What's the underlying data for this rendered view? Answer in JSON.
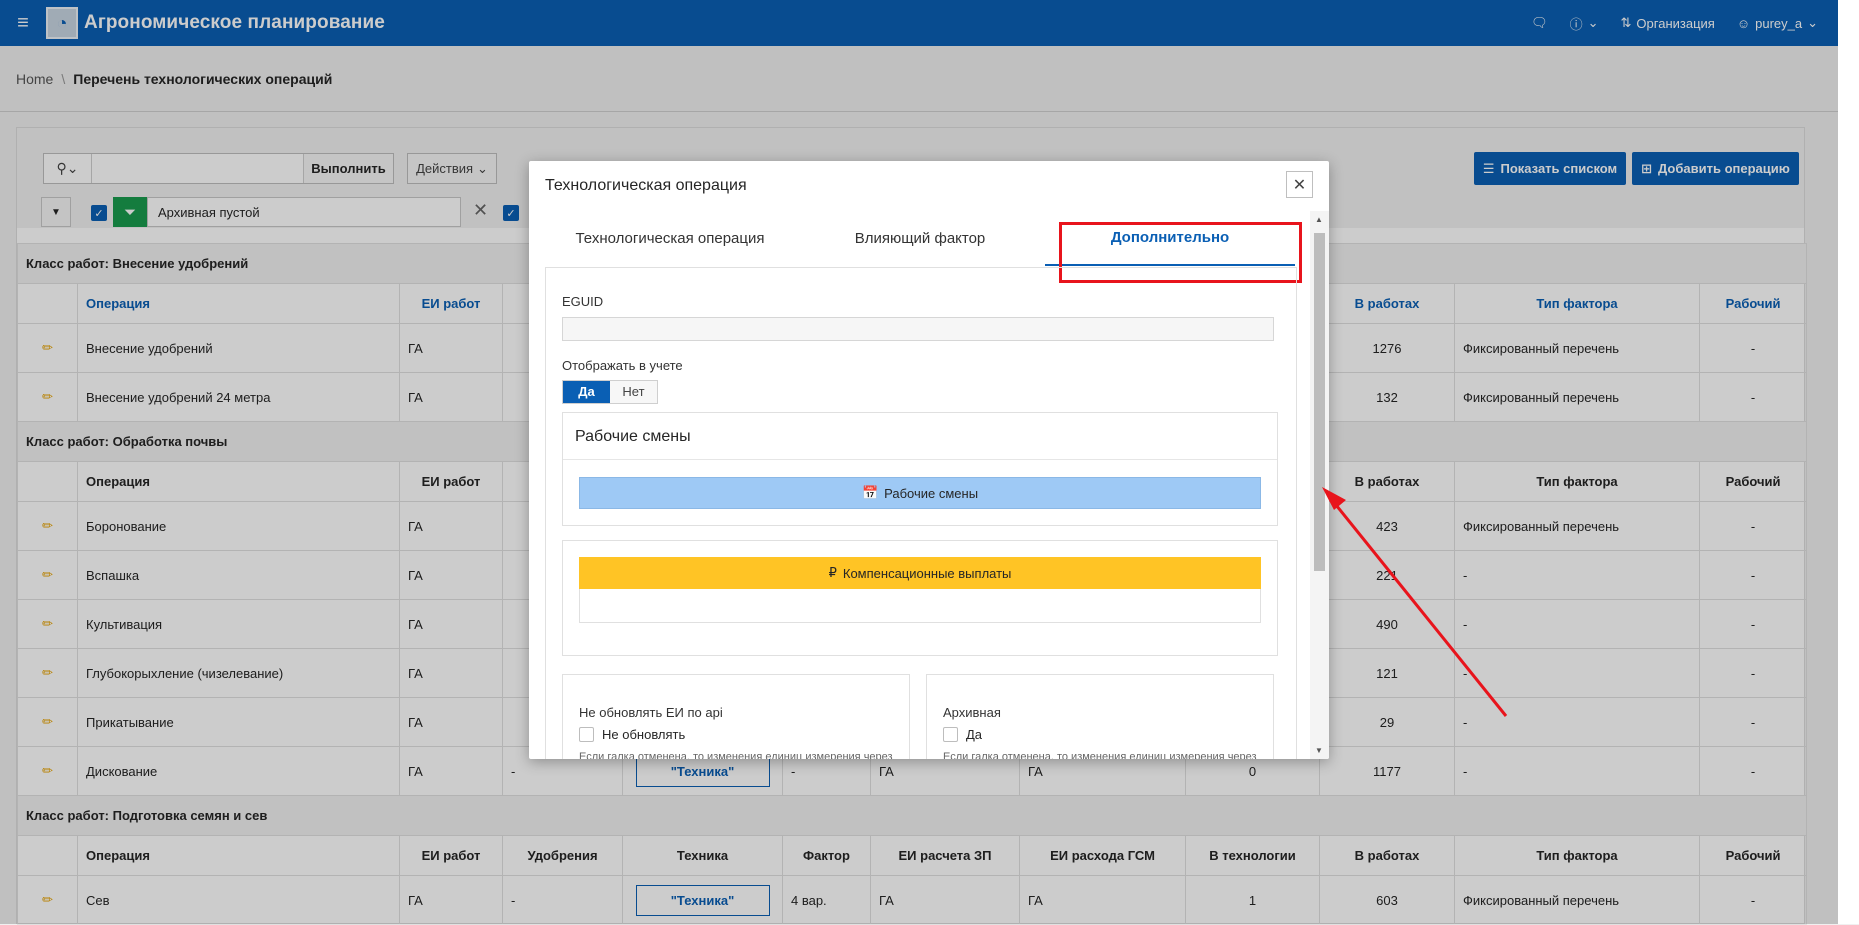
{
  "app": {
    "title": "Агрономическое планирование"
  },
  "header": {
    "organization": "Организация",
    "user": "purey_a"
  },
  "breadcrumb": {
    "home": "Home",
    "current": "Перечень технологических операций"
  },
  "toolbar": {
    "go_label": "Выполнить",
    "actions_label": "Действия",
    "show_list_label": "Показать списком",
    "add_operation_label": "Добавить операцию",
    "filter_text": "Архивная пустой"
  },
  "table": {
    "groups": [
      {
        "title": "Класс работ: Внесение удобрений"
      },
      {
        "title": "Класс работ: Обработка почвы"
      },
      {
        "title": "Класс работ: Подготовка семян и сев"
      }
    ],
    "headers": {
      "operation": "Операция",
      "unit": "ЕИ работ",
      "fertilizer": "Удобрения",
      "tech": "Техника",
      "factor": "Фактор",
      "wage_unit": "ЕИ расчета ЗП",
      "fuel_unit": "ЕИ расхода ГСМ",
      "in_tech": "В технологии",
      "in_works": "В работах",
      "factor_type": "Тип фактора",
      "worker": "Рабочий"
    },
    "rows": [
      {
        "op": "Внесение удобрений",
        "unit": "ГА",
        "works": "1276",
        "type": "Фиксированный перечень",
        "worker": "-"
      },
      {
        "op": "Внесение удобрений 24 метра",
        "unit": "ГА",
        "works": "132",
        "type": "Фиксированный перечень",
        "worker": "-"
      },
      {
        "op": "Боронование",
        "unit": "ГА",
        "works": "423",
        "type": "Фиксированный перечень",
        "worker": "-"
      },
      {
        "op": "Вспашка",
        "unit": "ГА",
        "works": "221",
        "type": "-",
        "worker": "-"
      },
      {
        "op": "Культивация",
        "unit": "ГА",
        "works": "490",
        "type": "-",
        "worker": "-"
      },
      {
        "op": "Глубокорыхление (чизелевание)",
        "unit": "ГА",
        "works": "121",
        "type": "-",
        "worker": "-"
      },
      {
        "op": "Прикатывание",
        "unit": "ГА",
        "works": "29",
        "type": "-",
        "worker": "-"
      },
      {
        "op": "Дискование",
        "unit": "ГА",
        "fert": "-",
        "tech": "\"Техника\"",
        "factor": "-",
        "wage": "ГА",
        "fuel": "ГА",
        "intech": "0",
        "works": "1177",
        "type": "-",
        "worker": "-"
      },
      {
        "op": "Сев",
        "unit": "ГА",
        "fert": "-",
        "tech": "\"Техника\"",
        "factor": "4 вар.",
        "wage": "ГА",
        "fuel": "ГА",
        "intech": "1",
        "works": "603",
        "type": "Фиксированный перечень",
        "worker": "-"
      }
    ]
  },
  "dialog": {
    "title": "Технологическая операция",
    "tabs": [
      "Технологическая операция",
      "Влияющий фактор",
      "Дополнительно"
    ],
    "eguid_label": "EGUID",
    "show_in_accounting_label": "Отображать в учете",
    "yes": "Да",
    "no": "Нет",
    "shifts_panel_title": "Рабочие смены",
    "shifts_button": "Рабочие смены",
    "compensation_button": "Компенсационные выплаты",
    "no_update_label": "Не обновлять ЕИ по api",
    "no_update_checkbox": "Не обновлять",
    "archive_label": "Архивная",
    "archive_checkbox": "Да",
    "hint_text": "Если галка отменена, то изменения единиц измерения через"
  },
  "colors": {
    "brand": "#0a5fb4",
    "highlight": "#e8141c",
    "shifts_btn": "#9ec9f5",
    "comp_btn": "#ffc425"
  }
}
